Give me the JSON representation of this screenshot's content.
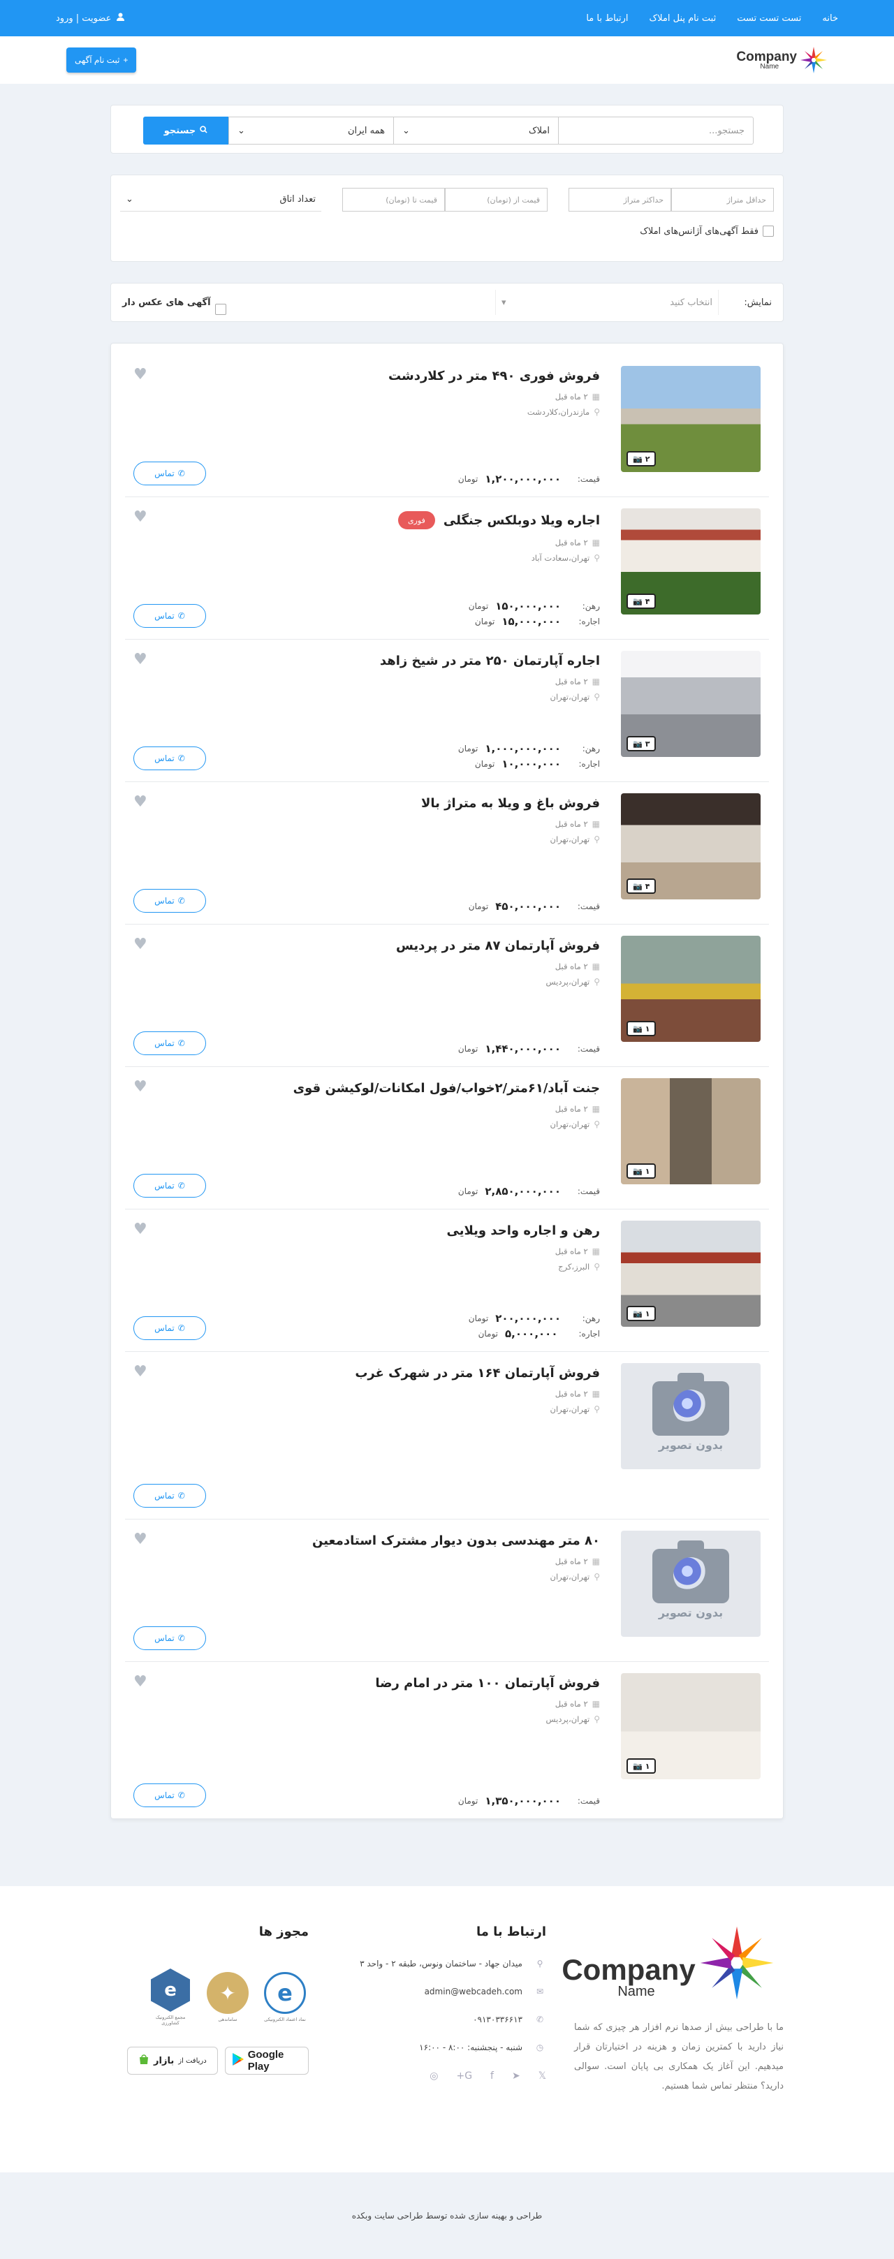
{
  "topnav": {
    "links": [
      "خانه",
      "تست تست تست",
      "ثبت نام پنل املاک",
      "ارتباط با ما"
    ],
    "user": "عضویت | ورود"
  },
  "header": {
    "logo_company": "Company",
    "logo_name": "Name",
    "post_button": "ثبت نام آگهی"
  },
  "search": {
    "placeholder": "جستجو...",
    "type_value": "املاک",
    "city_value": "همه ایران",
    "button": "جستجو"
  },
  "filters": {
    "area_min": "حداقل متراژ",
    "area_max": "حداکثر متراژ",
    "price_from": "قیمت از (تومان)",
    "price_to": "قیمت تا (تومان)",
    "rooms": "تعداد اتاق",
    "agency_only": "فقط آگهی‌های آژانس‌های املاک"
  },
  "sortbar": {
    "label": "نمایش:",
    "select_placeholder": "انتخاب کنید",
    "with_photo": "آگهی های عکس دار"
  },
  "listings": [
    {
      "title": "فروش فوری ۴۹۰ متر در کلاردشت",
      "time": "۲ ماه قبل",
      "location": "مازندران،کلاردشت",
      "photos": "۲",
      "price_label": "قیمت:",
      "price": "۱,۲۰۰,۰۰۰,۰۰۰",
      "unit": "تومان",
      "call": "تماس",
      "img": "A"
    },
    {
      "title": "اجاره ویلا دوبلکس جنگلی",
      "badge": "فوری",
      "time": "۲ ماه قبل",
      "location": "تهران،سعادت آباد",
      "photos": "۴",
      "deposit_label": "رهن:",
      "deposit": "۱۵۰,۰۰۰,۰۰۰",
      "rent_label": "اجاره:",
      "rent": "۱۵,۰۰۰,۰۰۰",
      "unit": "تومان",
      "call": "تماس",
      "img": "B"
    },
    {
      "title": "اجاره آپارتمان ۲۵۰ متر در شیخ زاهد",
      "time": "۲ ماه قبل",
      "location": "تهران،تهران",
      "photos": "۳",
      "deposit_label": "رهن:",
      "deposit": "۱,۰۰۰,۰۰۰,۰۰۰",
      "rent_label": "اجاره:",
      "rent": "۱۰,۰۰۰,۰۰۰",
      "unit": "تومان",
      "call": "تماس",
      "img": "C"
    },
    {
      "title": "فروش باغ و ویلا به متراژ بالا",
      "time": "۲ ماه قبل",
      "location": "تهران،تهران",
      "photos": "۴",
      "price_label": "قیمت:",
      "price": "۴۵۰,۰۰۰,۰۰۰",
      "unit": "تومان",
      "call": "تماس",
      "img": "D"
    },
    {
      "title": "فروش آپارتمان ۸۷ متر در پردیس",
      "time": "۲ ماه قبل",
      "location": "تهران،پردیس",
      "photos": "۱",
      "price_label": "قیمت:",
      "price": "۱,۴۴۰,۰۰۰,۰۰۰",
      "unit": "تومان",
      "call": "تماس",
      "img": "E"
    },
    {
      "title": "جنت آباد/۶۱متر/۲خواب/فول امکانات/لوکیشن قوی",
      "time": "۲ ماه قبل",
      "location": "تهران،تهران",
      "photos": "۱",
      "price_label": "قیمت:",
      "price": "۲,۸۵۰,۰۰۰,۰۰۰",
      "unit": "تومان",
      "call": "تماس",
      "img": "F"
    },
    {
      "title": "رهن و اجاره واحد ویلایی",
      "time": "۲ ماه قبل",
      "location": "البرز،کرج",
      "photos": "۱",
      "deposit_label": "رهن:",
      "deposit": "۲۰۰,۰۰۰,۰۰۰",
      "rent_label": "اجاره:",
      "rent": "۵,۰۰۰,۰۰۰",
      "unit": "تومان",
      "call": "تماس",
      "img": "G"
    },
    {
      "title": "فروش آپارتمان ۱۶۴ متر در شهرک غرب",
      "time": "۲ ماه قبل",
      "location": "تهران،تهران",
      "noimg": "بدون تصویر",
      "call": "تماس",
      "tall": true
    },
    {
      "title": "۸۰ متر مهندسی بدون دیوار مشترک استادمعین",
      "time": "۲ ماه قبل",
      "location": "تهران،تهران",
      "noimg": "بدون تصویر",
      "call": "تماس"
    },
    {
      "title": "فروش آپارتمان ۱۰۰ متر در امام رضا",
      "time": "۲ ماه قبل",
      "location": "تهران،پردیس",
      "photos": "۱",
      "price_label": "قیمت:",
      "price": "۱,۳۵۰,۰۰۰,۰۰۰",
      "unit": "تومان",
      "call": "تماس",
      "img": "H"
    }
  ],
  "footer": {
    "about": "ما با طراحی بیش از صدها نرم افزار هر چیزی که شما نیاز دارید با کمترین زمان و هزینه در اختیارتان قرار میدهیم. این آغاز یک همکاری بی پایان است. سوالی دارید؟ منتظر تماس شما هستیم.",
    "contact_title": "ارتباط با ما",
    "address": "میدان جهاد - ساختمان ونوس، طبقه ۲ - واحد ۳",
    "email": "admin@webcadeh.com",
    "phone": "۰۹۱۳۰۳۳۶۶۱۳",
    "hours": "شنبه - پنجشنبه: ۸:۰۰ - ۱۶:۰۰",
    "licenses_title": "مجوز ها",
    "lic1_text": "نماد اعتماد الکترونیکی",
    "lic2_text": "ساماندهی",
    "lic3_text": "مجمع الکترونیک کشاورزی",
    "google_play": "Google Play",
    "bazaar_prefix": "دریافت از",
    "bazaar": "بازار",
    "copyright": "طراحی و بهینه سازی شده توسط طراحی سایت وبکده"
  },
  "colors": {
    "primary": "#2196f3",
    "badge": "#e85a5a"
  }
}
